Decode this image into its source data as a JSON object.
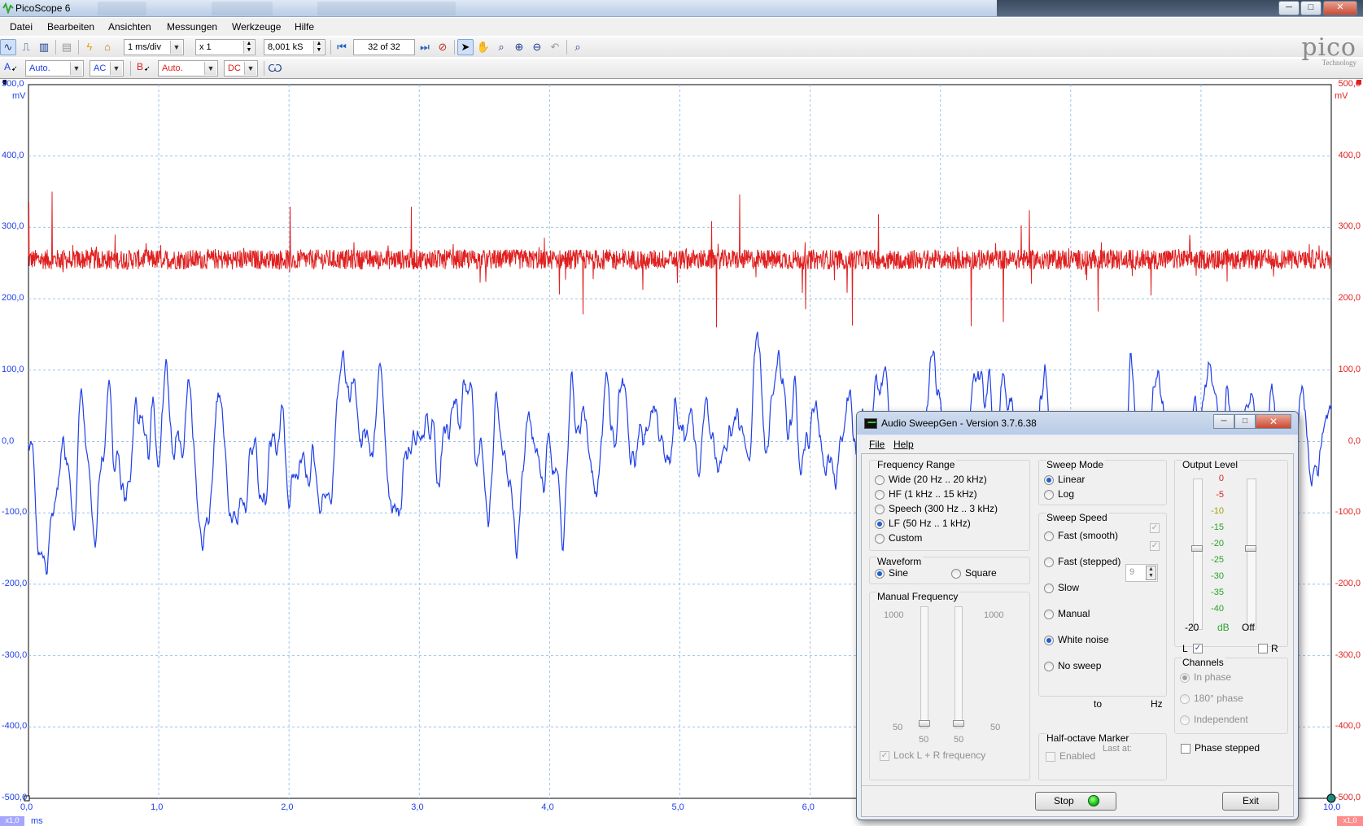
{
  "window": {
    "title": "PicoScope 6",
    "controls": {
      "minimize": "─",
      "maximize": "□",
      "close": "✕"
    }
  },
  "menu": [
    "Datei",
    "Bearbeiten",
    "Ansichten",
    "Messungen",
    "Werkzeuge",
    "Hilfe"
  ],
  "toolbar": {
    "timebase": "1 ms/div",
    "zoom": "x 1",
    "samples": "8,001 kS",
    "buffer": "32 of 32"
  },
  "channels": {
    "a": {
      "label": "A",
      "range": "Auto.",
      "coupling": "AC",
      "color": "#1f3fe8"
    },
    "b": {
      "label": "B",
      "range": "Auto.",
      "coupling": "DC",
      "color": "#e02020"
    }
  },
  "logo": {
    "name": "pico",
    "sub": "Technology"
  },
  "scope": {
    "y_labels_left": [
      "500,0",
      "400,0",
      "300,0",
      "200,0",
      "100,0",
      "0,0",
      "-100,0",
      "-200,0",
      "-300,0",
      "-400,0",
      "-500,0"
    ],
    "y_labels_right": [
      "500,0",
      "400,0",
      "300,0",
      "200,0",
      "100,0",
      "0,0",
      "-100,0",
      "-200,0",
      "-300,0",
      "-400,0",
      "-500,0"
    ],
    "y_unit_left": "mV",
    "y_unit_right": "mV",
    "x_labels": [
      "0,0",
      "1,0",
      "2,0",
      "3,0",
      "4,0",
      "5,0",
      "6,0",
      "10,0"
    ],
    "x_unit": "ms",
    "zoom_left": "x1,0",
    "zoom_right": "x1,0",
    "chart_data": {
      "type": "line",
      "xlabel": "ms",
      "ylabel": "mV",
      "xlim": [
        0,
        10
      ],
      "ylim": [
        -500,
        500
      ],
      "grid": true,
      "series": [
        {
          "name": "A",
          "color": "#1f3fe8",
          "description_level_mV": 0,
          "peak_range_mV": [
            -245,
            195
          ]
        },
        {
          "name": "B",
          "color": "#e02020",
          "description_level_mV": 255,
          "peak_range_mV": [
            160,
            350
          ]
        }
      ]
    }
  },
  "dialog": {
    "title": "Audio SweepGen - Version 3.7.6.38",
    "menu": {
      "file": "File",
      "help": "Help"
    },
    "frequency_range": {
      "label": "Frequency Range",
      "options": [
        "Wide  (20 Hz .. 20 kHz)",
        "HF  (1 kHz .. 15 kHz)",
        "Speech  (300 Hz .. 3 kHz)",
        "LF  (50 Hz .. 1 kHz)",
        "Custom"
      ],
      "selected": 3
    },
    "waveform": {
      "label": "Waveform",
      "sine": "Sine",
      "square": "Square",
      "selected": "sine"
    },
    "manual_frequency": {
      "label": "Manual Frequency",
      "top_left": "1000",
      "top_right": "1000",
      "bottom_left": "50",
      "bottom_right": "50",
      "slider_left": "50",
      "slider_right": "50",
      "lock": "Lock L + R frequency"
    },
    "sweep_mode": {
      "label": "Sweep Mode",
      "linear": "Linear",
      "log": "Log",
      "selected": "linear"
    },
    "sweep_speed": {
      "label": "Sweep Speed",
      "options": [
        "Fast (smooth)",
        "Fast (stepped)",
        "Slow",
        "Manual",
        "White noise",
        "No sweep"
      ],
      "selected": 4,
      "step_value": "9",
      "to": "to",
      "hz": "Hz"
    },
    "half_octave": {
      "label": "Half-octave Marker",
      "enabled": "Enabled",
      "last_at": "Last at:"
    },
    "output_level": {
      "label": "Output Level",
      "levels": [
        "0",
        "-5",
        "-10",
        "-15",
        "-20",
        "-25",
        "-30",
        "-35",
        "-40"
      ],
      "left_value": "-20",
      "unit": "dB",
      "right_value": "Off",
      "left_channel": "L",
      "right_channel": "R"
    },
    "channels": {
      "label": "Channels",
      "in_phase": "In phase",
      "phase180": "180° phase",
      "independent": "Independent"
    },
    "phase_stepped": "Phase stepped",
    "stop": "Stop",
    "exit": "Exit"
  }
}
